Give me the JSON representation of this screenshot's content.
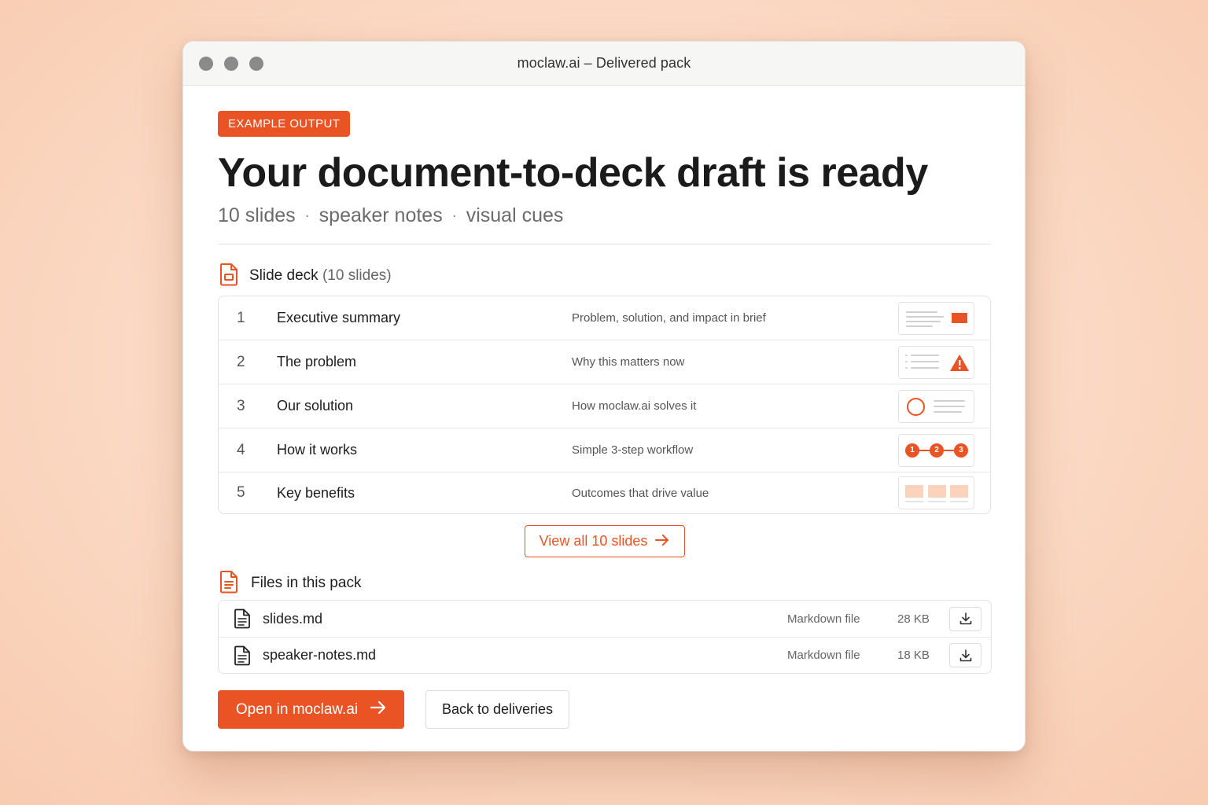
{
  "window": {
    "title": "moclaw.ai – Delivered pack"
  },
  "header": {
    "badge": "EXAMPLE OUTPUT",
    "title": "Your document-to-deck draft is ready",
    "subtitle_parts": [
      "10 slides",
      "speaker notes",
      "visual cues"
    ],
    "separator": "·"
  },
  "slide_deck": {
    "label": "Slide deck",
    "count_label": "(10 slides)",
    "rows": [
      {
        "number": "1",
        "title": "Executive summary",
        "description": "Problem, solution, and impact in brief",
        "thumb_icon": "summary-thumbnail-icon"
      },
      {
        "number": "2",
        "title": "The problem",
        "description": "Why this matters now",
        "thumb_icon": "warning-thumbnail-icon"
      },
      {
        "number": "3",
        "title": "Our solution",
        "description": "How moclaw.ai solves it",
        "thumb_icon": "circle-thumbnail-icon"
      },
      {
        "number": "4",
        "title": "How it works",
        "description": "Simple 3-step workflow",
        "thumb_icon": "steps-thumbnail-icon",
        "steps": [
          "1",
          "2",
          "3"
        ]
      },
      {
        "number": "5",
        "title": "Key benefits",
        "description": "Outcomes that drive value",
        "thumb_icon": "cards-thumbnail-icon"
      }
    ],
    "view_all_label": "View all 10 slides"
  },
  "files": {
    "label": "Files in this pack",
    "rows": [
      {
        "name": "slides.md",
        "type": "Markdown file",
        "size": "28 KB"
      },
      {
        "name": "speaker-notes.md",
        "type": "Markdown file",
        "size": "18 KB"
      }
    ]
  },
  "actions": {
    "primary_label": "Open in moclaw.ai",
    "secondary_label": "Back to deliveries"
  },
  "colors": {
    "accent": "#ea5424",
    "accent_light": "#fbd3bd",
    "background": "#fbd9c4"
  }
}
